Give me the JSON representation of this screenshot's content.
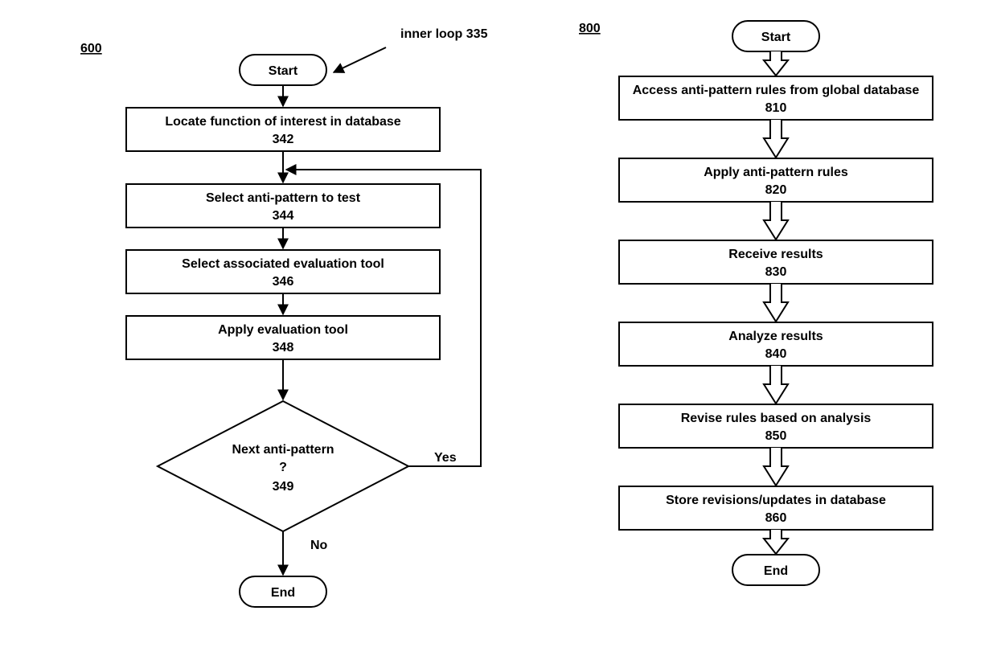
{
  "left": {
    "fig_num": "600",
    "pointer_label": "inner loop 335",
    "start": "Start",
    "end": "End",
    "yes": "Yes",
    "no": "No",
    "boxes": {
      "b342": {
        "title": "Locate function of interest in database",
        "num": "342"
      },
      "b344": {
        "title": "Select anti-pattern to test",
        "num": "344"
      },
      "b346": {
        "title": "Select associated evaluation tool",
        "num": "346"
      },
      "b348": {
        "title": "Apply evaluation tool",
        "num": "348"
      },
      "d349": {
        "line1": "Next anti-pattern",
        "line2": "?",
        "num": "349"
      }
    }
  },
  "right": {
    "fig_num": "800",
    "start": "Start",
    "end": "End",
    "boxes": {
      "b810": {
        "title": "Access anti-pattern rules from global database",
        "num": "810"
      },
      "b820": {
        "title": "Apply anti-pattern rules",
        "num": "820"
      },
      "b830": {
        "title": "Receive results",
        "num": "830"
      },
      "b840": {
        "title": "Analyze results",
        "num": "840"
      },
      "b850": {
        "title": "Revise rules based on analysis",
        "num": "850"
      },
      "b860": {
        "title": "Store revisions/updates in database",
        "num": "860"
      }
    }
  }
}
